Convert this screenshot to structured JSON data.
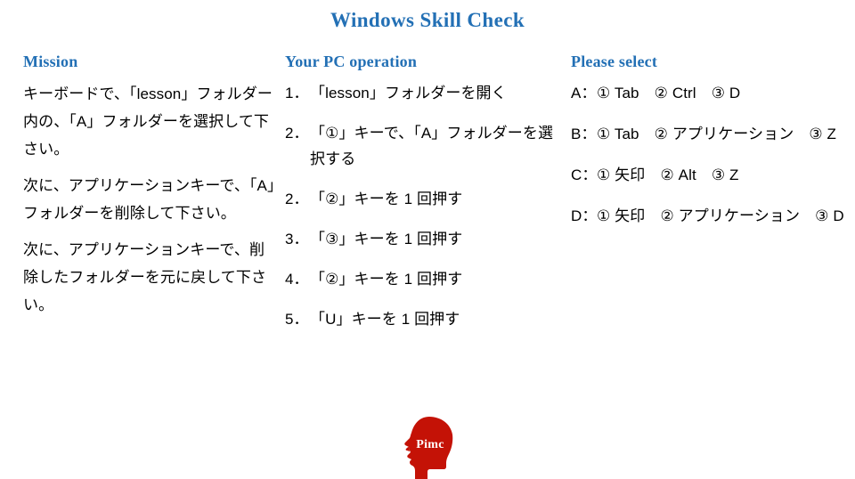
{
  "slide": {
    "title": "Windows Skill Check",
    "background_color": "#ffffff",
    "accent_color": "#2370b5",
    "text_color": "#000000"
  },
  "columns": {
    "mission": {
      "heading": "Mission",
      "paragraphs": [
        "キーボードで、「lesson」フォルダー内の、「A」フォルダーを選択して下さい。",
        "次に、アプリケーションキーで、「A」フォルダーを削除して下さい。",
        "次に、アプリケーションキーで、削除したフォルダーを元に戻して下さい。"
      ]
    },
    "operation": {
      "heading": "Your PC operation",
      "steps": [
        {
          "number": "1．",
          "text": "「lesson」フォルダーを開く"
        },
        {
          "number": "2．",
          "text": "「①」キーで、「A」フォルダーを選択する"
        },
        {
          "number": "2．",
          "text": "「②」キーを 1 回押す"
        },
        {
          "number": "3．",
          "text": "「③」キーを 1 回押す"
        },
        {
          "number": "4．",
          "text": "「②」キーを 1 回押す"
        },
        {
          "number": "5．",
          "text": "「U」キーを 1 回押す"
        }
      ]
    },
    "select": {
      "heading": "Please select",
      "options": [
        {
          "key": "A：",
          "text": "① Tab　② Ctrl　③ D"
        },
        {
          "key": "B：",
          "text": "① Tab　② アプリケーション　③ Z"
        },
        {
          "key": "C：",
          "text": "① 矢印　② Alt　③ Z"
        },
        {
          "key": "D：",
          "text": "① 矢印　② アプリケーション　③ D"
        }
      ]
    }
  },
  "logo": {
    "name": "pimc-head-logo",
    "word": "Pimc",
    "color": "#c41206"
  }
}
